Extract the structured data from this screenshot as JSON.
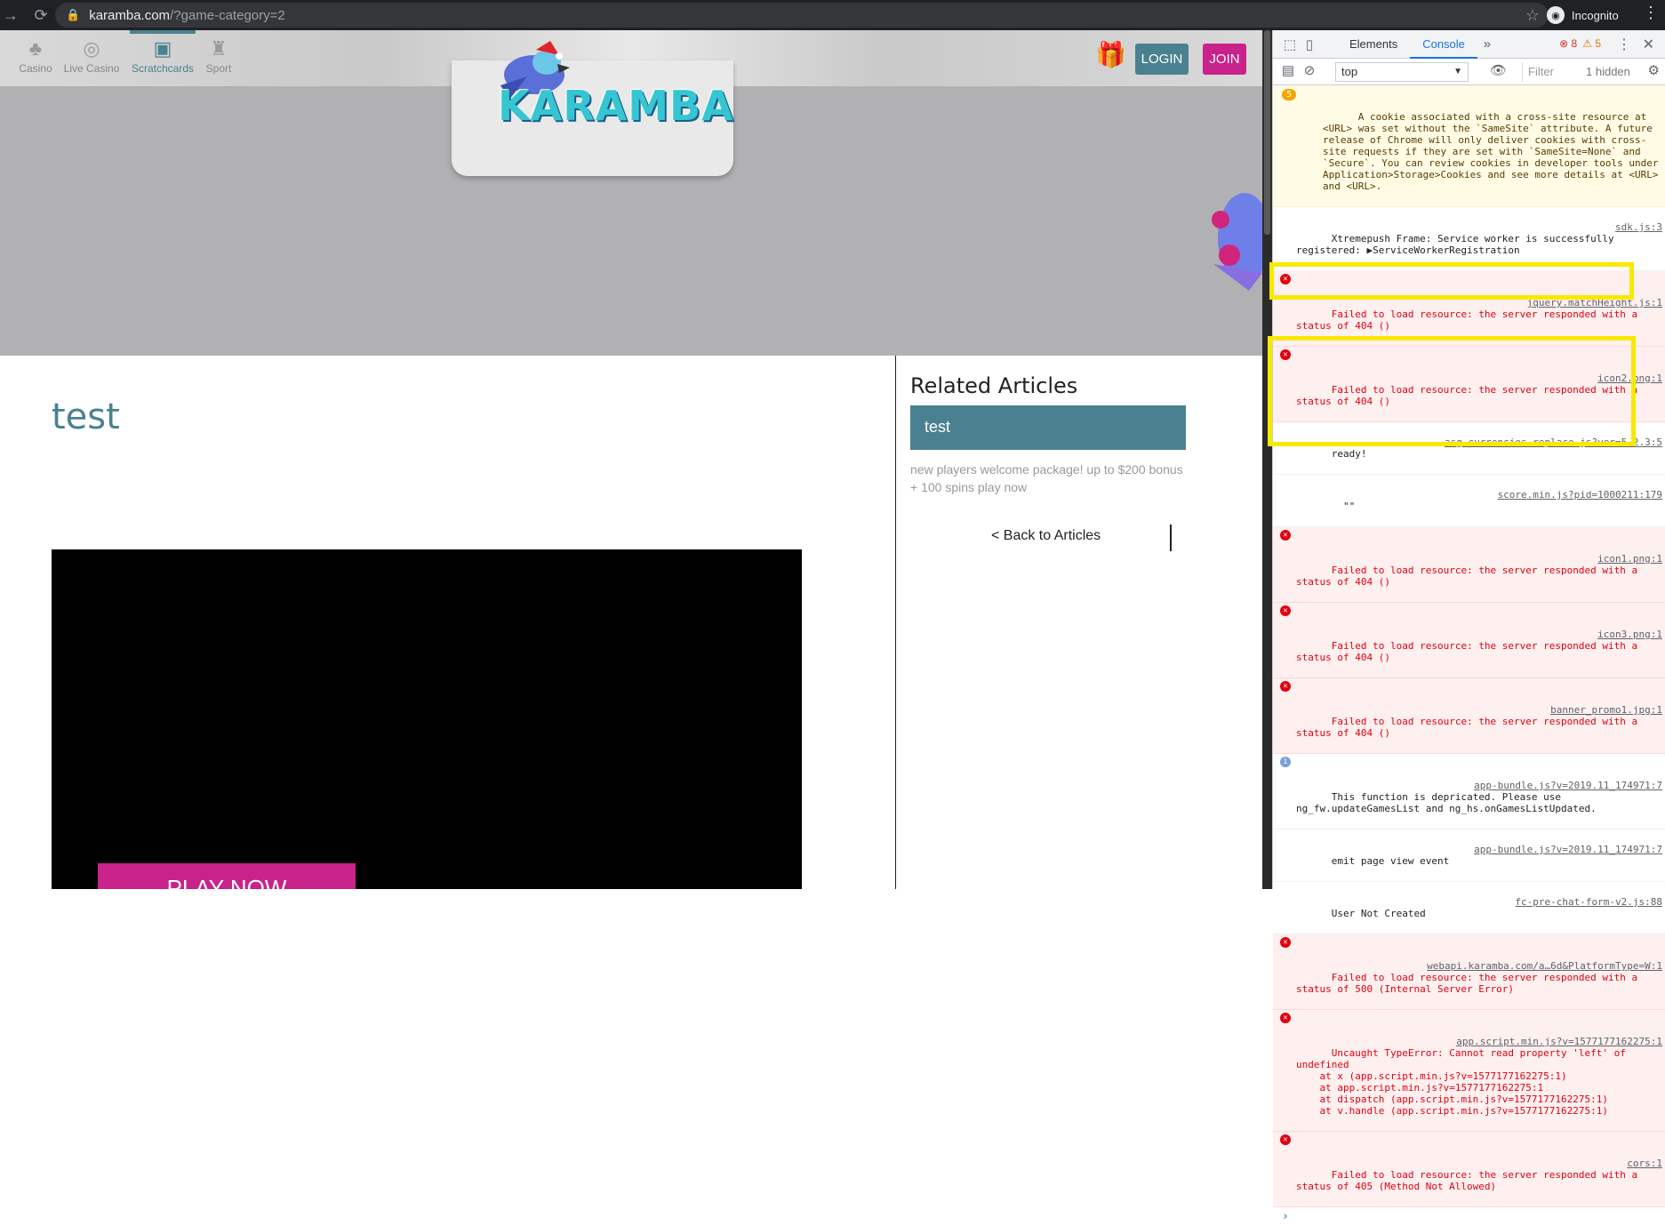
{
  "browser": {
    "url_host": "karamba.com",
    "url_path": "/?game-category=2",
    "incognito_label": "Incognito"
  },
  "site": {
    "nav": [
      {
        "label": "Casino",
        "icon": "clover-icon"
      },
      {
        "label": "Live Casino",
        "icon": "chip-icon"
      },
      {
        "label": "Scratchcards",
        "icon": "scratchcard-icon"
      },
      {
        "label": "Sport",
        "icon": "trophy-icon"
      }
    ],
    "logo_text": "KARAMBA",
    "login_label": "LOGIN",
    "join_label": "JOIN",
    "article_title": "test",
    "play_now_label": "PLAY NOW",
    "related_heading": "Related Articles",
    "related_card_title": "test",
    "related_desc": "new players welcome package! up to $200 bonus + 100 spins play now",
    "back_link": "< Back to Articles"
  },
  "devtools": {
    "tabs": [
      "Elements",
      "Console"
    ],
    "active_tab": "Console",
    "error_count": "8",
    "warning_count": "5",
    "context": "top",
    "filter_placeholder": "Filter",
    "hidden_label": "1 hidden",
    "messages": [
      {
        "type": "warn",
        "badge": "5",
        "text": "A cookie associated with a cross-site resource at <URL> was set without the `SameSite` attribute. A future release of Chrome will only deliver cookies with cross-site requests if they are set with `SameSite=None` and `Secure`. You can review cookies in developer tools under Application>Storage>Cookies and see more details at <URL> and <URL>.",
        "src": ""
      },
      {
        "type": "log",
        "text": "Xtremepush Frame: Service worker is successfully registered: ▶ServiceWorkerRegistration",
        "src": "sdk.js:3"
      },
      {
        "type": "err",
        "text": "Failed to load resource: the server responded with a status of 404 ()",
        "src": "jquery.matchHeight.js:1"
      },
      {
        "type": "err",
        "text": "Failed to load resource: the server responded with a status of 404 ()",
        "src": "icon2.png:1"
      },
      {
        "type": "log",
        "text": "ready!",
        "src": "asg-currencies-replace.js?ver=5.2.3:5"
      },
      {
        "type": "log",
        "text": "  \"\"",
        "src": "score.min.js?pid=1000211:179"
      },
      {
        "type": "err",
        "text": "Failed to load resource: the server responded with a status of 404 ()",
        "src": "icon1.png:1"
      },
      {
        "type": "err",
        "text": "Failed to load resource: the server responded with a status of 404 ()",
        "src": "icon3.png:1"
      },
      {
        "type": "err",
        "text": "Failed to load resource: the server responded with a status of 404 ()",
        "src": "banner_promo1.jpg:1"
      },
      {
        "type": "info",
        "text": "This function is depricated. Please use ng_fw.updateGamesList and ng_hs.onGamesListUpdated.",
        "src": "app-bundle.js?v=2019.11_174971:7"
      },
      {
        "type": "log",
        "text": "emit page view event",
        "src": "app-bundle.js?v=2019.11_174971:7"
      },
      {
        "type": "log",
        "text": "User Not Created",
        "src": "fc-pre-chat-form-v2.js:88"
      },
      {
        "type": "err",
        "text": "Failed to load resource: the server responded with a status of 500 (Internal Server Error)",
        "src": "webapi.karamba.com/a…6d&PlatformType=W:1"
      },
      {
        "type": "err",
        "text": "Uncaught TypeError: Cannot read property 'left' of undefined\n    at x (app.script.min.js?v=1577177162275:1)\n    at app.script.min.js?v=1577177162275:1\n    at dispatch (app.script.min.js?v=1577177162275:1)\n    at v.handle (app.script.min.js?v=1577177162275:1)",
        "src": "app.script.min.js?v=1577177162275:1"
      },
      {
        "type": "err",
        "text": "Failed to load resource: the server responded with a status of 405 (Method Not Allowed)",
        "src": "cors:1"
      }
    ]
  },
  "colors": {
    "teal": "#4a8190",
    "magenta": "#c9228a",
    "highlight": "#f7e900"
  }
}
